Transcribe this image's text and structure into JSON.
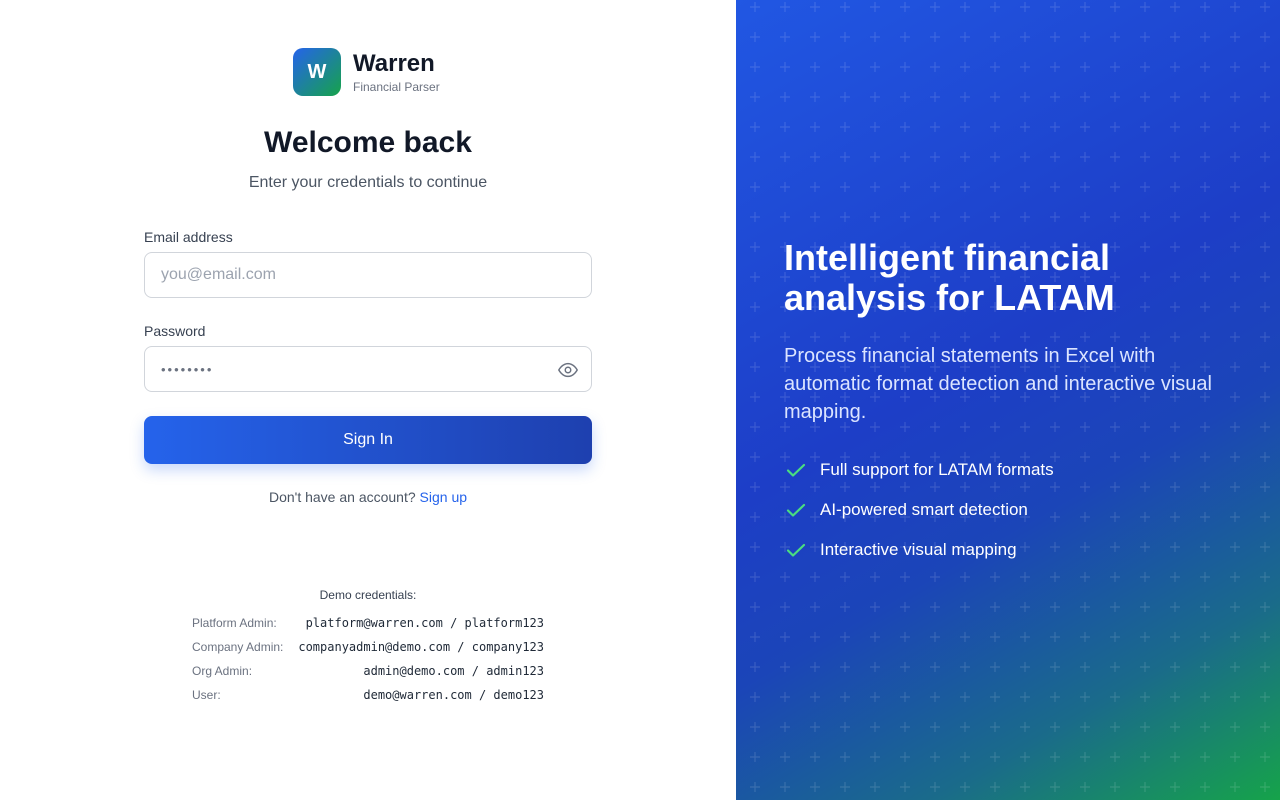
{
  "brand": {
    "logo_letter": "W",
    "name": "Warren",
    "tagline": "Financial Parser"
  },
  "form": {
    "title": "Welcome back",
    "subtitle": "Enter your credentials to continue",
    "email_label": "Email address",
    "email_placeholder": "you@email.com",
    "password_label": "Password",
    "password_mask": "••••••••",
    "signin_label": "Sign In",
    "no_account_text": "Don't have an account?",
    "signup_link": "Sign up"
  },
  "demo": {
    "title": "Demo credentials:",
    "rows": [
      {
        "role": "Platform Admin:",
        "cred": "platform@warren.com / platform123"
      },
      {
        "role": "Company Admin:",
        "cred": "companyadmin@demo.com / company123"
      },
      {
        "role": "Org Admin:",
        "cred": "admin@demo.com / admin123"
      },
      {
        "role": "User:",
        "cred": "demo@warren.com / demo123"
      }
    ]
  },
  "hero": {
    "title": "Intelligent financial analysis for LATAM",
    "description": "Process financial statements in Excel with automatic format detection and interactive visual mapping.",
    "features": [
      {
        "icon": "check-icon",
        "label": "Full support for LATAM formats"
      },
      {
        "icon": "check-icon",
        "label": "AI-powered smart detection"
      },
      {
        "icon": "check-icon",
        "label": "Interactive visual mapping"
      }
    ]
  },
  "colors": {
    "primary": "#2563eb",
    "primary_dark": "#1e40af",
    "accent_green": "#4ade80",
    "brand_gradient_end": "#16a34a"
  }
}
